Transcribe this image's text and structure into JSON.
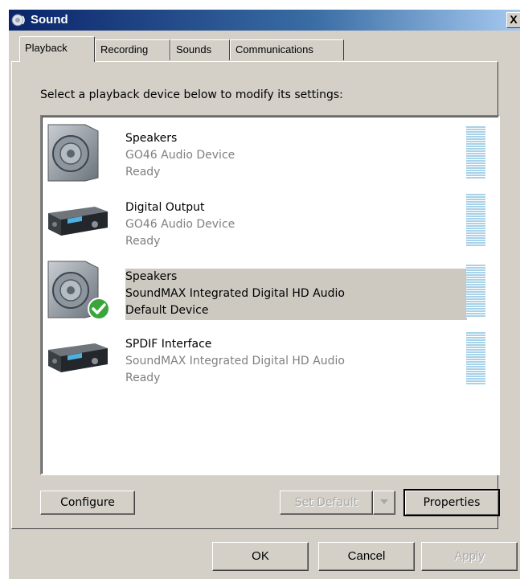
{
  "window": {
    "title": "Sound",
    "close_label": "X"
  },
  "tabs": [
    {
      "label": "Playback",
      "active": true
    },
    {
      "label": "Recording",
      "active": false
    },
    {
      "label": "Sounds",
      "active": false
    },
    {
      "label": "Communications",
      "active": false
    }
  ],
  "instruction": "Select a playback device below to modify its settings:",
  "devices": [
    {
      "name": "Speakers",
      "driver": "GO46 Audio Device",
      "status": "Ready",
      "icon": "speaker-icon",
      "selected": false
    },
    {
      "name": "Digital Output",
      "driver": "GO46 Audio Device",
      "status": "Ready",
      "icon": "digital-output-device-icon",
      "selected": false
    },
    {
      "name": "Speakers",
      "driver": "SoundMAX Integrated Digital HD Audio",
      "status": "Default Device",
      "icon": "speaker-icon",
      "default_badge_icon": "green-check-icon",
      "selected": true
    },
    {
      "name": "SPDIF Interface",
      "driver": "SoundMAX Integrated Digital HD Audio",
      "status": "Ready",
      "icon": "digital-output-device-icon",
      "selected": false
    }
  ],
  "buttons": {
    "configure": "Configure",
    "set_default": "Set Default",
    "properties": "Properties",
    "ok": "OK",
    "cancel": "Cancel",
    "apply": "Apply"
  },
  "colors": {
    "title_bar_start": "#0a246a",
    "dialog_bg": "#d4d0c8",
    "selection_bg": "#cdc9c1",
    "meter": "#a8d2e8",
    "check_green": "#3aa53a"
  }
}
